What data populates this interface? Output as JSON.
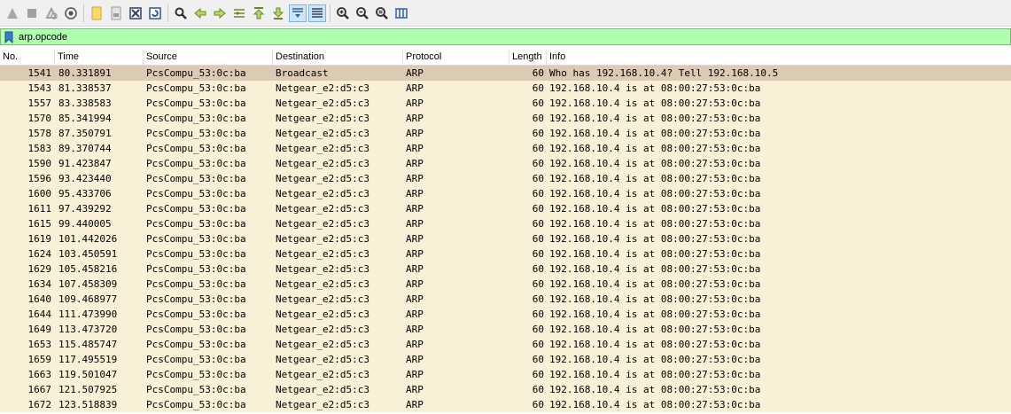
{
  "toolbar": {
    "icons": [
      "start-capture-icon",
      "stop-capture-icon",
      "restart-capture-icon",
      "capture-options-icon",
      "open-file-icon",
      "save-file-icon",
      "close-file-icon",
      "reload-file-icon",
      "find-packet-icon",
      "go-back-icon",
      "go-forward-icon",
      "go-to-packet-icon",
      "go-first-packet-icon",
      "go-last-packet-icon",
      "auto-scroll-icon",
      "colorize-icon",
      "zoom-in-icon",
      "zoom-out-icon",
      "zoom-normal-icon",
      "resize-columns-icon"
    ]
  },
  "filter": {
    "value": "arp.opcode"
  },
  "columns": {
    "no": "No.",
    "time": "Time",
    "source": "Source",
    "destination": "Destination",
    "protocol": "Protocol",
    "length": "Length",
    "info": "Info"
  },
  "colors": {
    "filter_valid_bg": "#afffaf",
    "row_bg": "#faf0d7",
    "selected_row_bg": "#dccbb4"
  },
  "packets": [
    {
      "no": "1541",
      "time": "80.331891",
      "source": "PcsCompu_53:0c:ba",
      "destination": "Broadcast",
      "protocol": "ARP",
      "length": "60",
      "info": "Who has 192.168.10.4? Tell 192.168.10.5",
      "selected": true
    },
    {
      "no": "1543",
      "time": "81.338537",
      "source": "PcsCompu_53:0c:ba",
      "destination": "Netgear_e2:d5:c3",
      "protocol": "ARP",
      "length": "60",
      "info": "192.168.10.4 is at 08:00:27:53:0c:ba"
    },
    {
      "no": "1557",
      "time": "83.338583",
      "source": "PcsCompu_53:0c:ba",
      "destination": "Netgear_e2:d5:c3",
      "protocol": "ARP",
      "length": "60",
      "info": "192.168.10.4 is at 08:00:27:53:0c:ba"
    },
    {
      "no": "1570",
      "time": "85.341994",
      "source": "PcsCompu_53:0c:ba",
      "destination": "Netgear_e2:d5:c3",
      "protocol": "ARP",
      "length": "60",
      "info": "192.168.10.4 is at 08:00:27:53:0c:ba"
    },
    {
      "no": "1578",
      "time": "87.350791",
      "source": "PcsCompu_53:0c:ba",
      "destination": "Netgear_e2:d5:c3",
      "protocol": "ARP",
      "length": "60",
      "info": "192.168.10.4 is at 08:00:27:53:0c:ba"
    },
    {
      "no": "1583",
      "time": "89.370744",
      "source": "PcsCompu_53:0c:ba",
      "destination": "Netgear_e2:d5:c3",
      "protocol": "ARP",
      "length": "60",
      "info": "192.168.10.4 is at 08:00:27:53:0c:ba"
    },
    {
      "no": "1590",
      "time": "91.423847",
      "source": "PcsCompu_53:0c:ba",
      "destination": "Netgear_e2:d5:c3",
      "protocol": "ARP",
      "length": "60",
      "info": "192.168.10.4 is at 08:00:27:53:0c:ba"
    },
    {
      "no": "1596",
      "time": "93.423440",
      "source": "PcsCompu_53:0c:ba",
      "destination": "Netgear_e2:d5:c3",
      "protocol": "ARP",
      "length": "60",
      "info": "192.168.10.4 is at 08:00:27:53:0c:ba"
    },
    {
      "no": "1600",
      "time": "95.433706",
      "source": "PcsCompu_53:0c:ba",
      "destination": "Netgear_e2:d5:c3",
      "protocol": "ARP",
      "length": "60",
      "info": "192.168.10.4 is at 08:00:27:53:0c:ba"
    },
    {
      "no": "1611",
      "time": "97.439292",
      "source": "PcsCompu_53:0c:ba",
      "destination": "Netgear_e2:d5:c3",
      "protocol": "ARP",
      "length": "60",
      "info": "192.168.10.4 is at 08:00:27:53:0c:ba"
    },
    {
      "no": "1615",
      "time": "99.440005",
      "source": "PcsCompu_53:0c:ba",
      "destination": "Netgear_e2:d5:c3",
      "protocol": "ARP",
      "length": "60",
      "info": "192.168.10.4 is at 08:00:27:53:0c:ba"
    },
    {
      "no": "1619",
      "time": "101.442026",
      "source": "PcsCompu_53:0c:ba",
      "destination": "Netgear_e2:d5:c3",
      "protocol": "ARP",
      "length": "60",
      "info": "192.168.10.4 is at 08:00:27:53:0c:ba"
    },
    {
      "no": "1624",
      "time": "103.450591",
      "source": "PcsCompu_53:0c:ba",
      "destination": "Netgear_e2:d5:c3",
      "protocol": "ARP",
      "length": "60",
      "info": "192.168.10.4 is at 08:00:27:53:0c:ba"
    },
    {
      "no": "1629",
      "time": "105.458216",
      "source": "PcsCompu_53:0c:ba",
      "destination": "Netgear_e2:d5:c3",
      "protocol": "ARP",
      "length": "60",
      "info": "192.168.10.4 is at 08:00:27:53:0c:ba"
    },
    {
      "no": "1634",
      "time": "107.458309",
      "source": "PcsCompu_53:0c:ba",
      "destination": "Netgear_e2:d5:c3",
      "protocol": "ARP",
      "length": "60",
      "info": "192.168.10.4 is at 08:00:27:53:0c:ba"
    },
    {
      "no": "1640",
      "time": "109.468977",
      "source": "PcsCompu_53:0c:ba",
      "destination": "Netgear_e2:d5:c3",
      "protocol": "ARP",
      "length": "60",
      "info": "192.168.10.4 is at 08:00:27:53:0c:ba"
    },
    {
      "no": "1644",
      "time": "111.473990",
      "source": "PcsCompu_53:0c:ba",
      "destination": "Netgear_e2:d5:c3",
      "protocol": "ARP",
      "length": "60",
      "info": "192.168.10.4 is at 08:00:27:53:0c:ba"
    },
    {
      "no": "1649",
      "time": "113.473720",
      "source": "PcsCompu_53:0c:ba",
      "destination": "Netgear_e2:d5:c3",
      "protocol": "ARP",
      "length": "60",
      "info": "192.168.10.4 is at 08:00:27:53:0c:ba"
    },
    {
      "no": "1653",
      "time": "115.485747",
      "source": "PcsCompu_53:0c:ba",
      "destination": "Netgear_e2:d5:c3",
      "protocol": "ARP",
      "length": "60",
      "info": "192.168.10.4 is at 08:00:27:53:0c:ba"
    },
    {
      "no": "1659",
      "time": "117.495519",
      "source": "PcsCompu_53:0c:ba",
      "destination": "Netgear_e2:d5:c3",
      "protocol": "ARP",
      "length": "60",
      "info": "192.168.10.4 is at 08:00:27:53:0c:ba"
    },
    {
      "no": "1663",
      "time": "119.501047",
      "source": "PcsCompu_53:0c:ba",
      "destination": "Netgear_e2:d5:c3",
      "protocol": "ARP",
      "length": "60",
      "info": "192.168.10.4 is at 08:00:27:53:0c:ba"
    },
    {
      "no": "1667",
      "time": "121.507925",
      "source": "PcsCompu_53:0c:ba",
      "destination": "Netgear_e2:d5:c3",
      "protocol": "ARP",
      "length": "60",
      "info": "192.168.10.4 is at 08:00:27:53:0c:ba"
    },
    {
      "no": "1672",
      "time": "123.518839",
      "source": "PcsCompu_53:0c:ba",
      "destination": "Netgear_e2:d5:c3",
      "protocol": "ARP",
      "length": "60",
      "info": "192.168.10.4 is at 08:00:27:53:0c:ba"
    }
  ]
}
